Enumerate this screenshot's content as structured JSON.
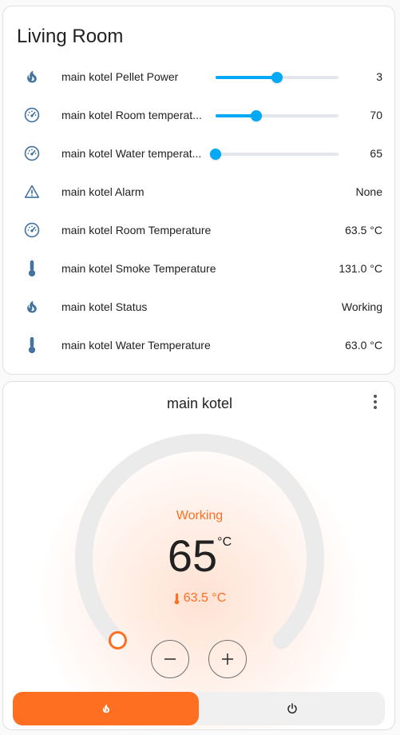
{
  "entities_card": {
    "title": "Living Room",
    "rows": [
      {
        "icon": "fire-icon",
        "name": "main kotel Pellet Power",
        "state": "3",
        "slider": 0.5
      },
      {
        "icon": "gauge-icon",
        "name": "main kotel Room temperat...",
        "state": "70",
        "slider": 0.33
      },
      {
        "icon": "gauge-icon",
        "name": "main kotel Water temperat...",
        "state": "65",
        "slider": 0.0
      },
      {
        "icon": "alert-icon",
        "name": "main kotel Alarm",
        "state": "None"
      },
      {
        "icon": "gauge-icon",
        "name": "main kotel Room Temperature",
        "state": "63.5 °C"
      },
      {
        "icon": "thermometer-icon",
        "name": "main kotel Smoke Temperature",
        "state": "131.0 °C"
      },
      {
        "icon": "fire-icon",
        "name": "main kotel Status",
        "state": "Working"
      },
      {
        "icon": "thermometer-icon",
        "name": "main kotel Water Temperature",
        "state": "63.0 °C"
      }
    ]
  },
  "thermostat_card": {
    "title": "main kotel",
    "hvac_action": "Working",
    "target": "65",
    "unit": "°C",
    "current": "63.5 °C",
    "dial_level": 0.0,
    "modes": [
      {
        "name": "heat",
        "icon": "fire-icon",
        "active": true
      },
      {
        "name": "off",
        "icon": "power-icon",
        "active": false
      }
    ]
  },
  "colors": {
    "accent": "#03a9f4",
    "heat": "#ff6f22",
    "icon": "#44739e",
    "track": "#e3e6ec"
  }
}
